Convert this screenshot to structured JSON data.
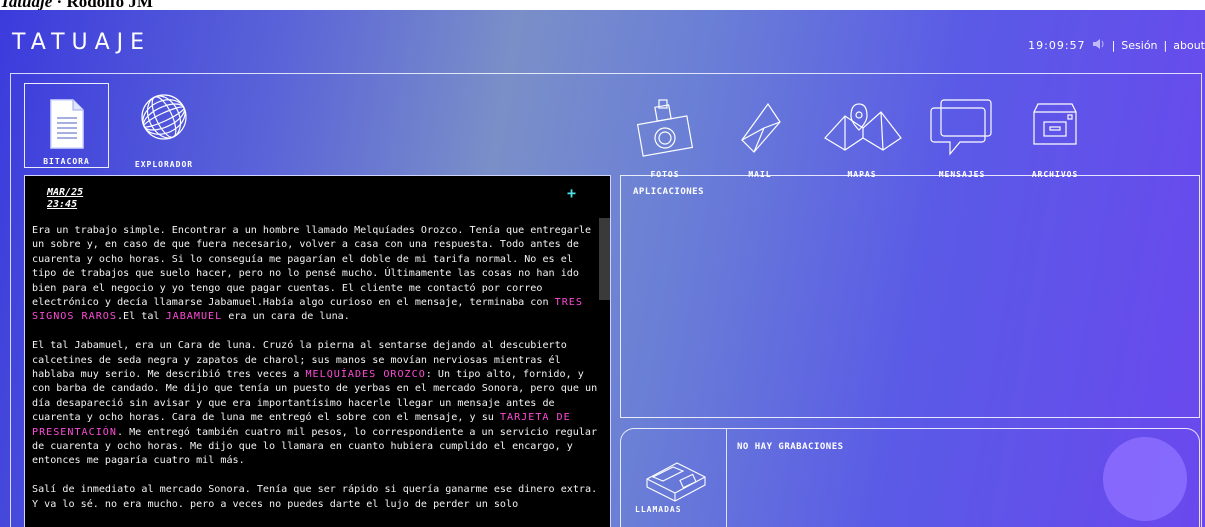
{
  "doc_title": {
    "italic": "Tatuaje",
    "rest": " · Rodolfo JM"
  },
  "app": {
    "logo": "TATUAJE",
    "clock": "19:09:57",
    "links": [
      "Sesión",
      "about"
    ],
    "separator": "|"
  },
  "left_icons": [
    {
      "label": "BITACORA",
      "icon": "document-icon",
      "selected": true
    },
    {
      "label": "EXPLORADOR",
      "icon": "globe-icon",
      "selected": false
    }
  ],
  "right_icons": [
    {
      "label": "FOTOS",
      "icon": "camera-icon"
    },
    {
      "label": "MAIL",
      "icon": "envelope-icon"
    },
    {
      "label": "MAPAS",
      "icon": "map-icon"
    },
    {
      "label": "MENSAJES",
      "icon": "chat-bubble-icon"
    },
    {
      "label": "ARCHIVOS",
      "icon": "file-cabinet-icon"
    }
  ],
  "bitacora": {
    "date": "MAR/25",
    "time": "23:45",
    "plus": "+",
    "p1a": "Era un trabajo simple. Encontrar a un hombre llamado Melquíades Orozco. Tenía que entregarle un sobre y, en caso de que fuera necesario, volver a casa con una respuesta. Todo antes de cuarenta y ocho horas. Si lo conseguía me pagarían el doble de mi tarifa normal. No es el tipo de trabajos que suelo hacer, pero no lo pensé mucho. Últimamente las cosas no han ido bien para el negocio y yo tengo que pagar cuentas. El cliente me contactó por correo electrónico y decía llamarse Jabamuel.Había algo curioso en el mensaje, terminaba con ",
    "p1_hl1": "TRES SIGNOS RAROS",
    "p1b": ".El tal ",
    "p1_hl2": "JABAMUEL",
    "p1c": " era un cara de luna.",
    "p2a": "El tal Jabamuel, era un Cara de luna. Cruzó la pierna al sentarse dejando al descubierto calcetines de seda negra y zapatos de charol; sus manos se movían nerviosas mientras él hablaba muy serio. Me describió tres veces a ",
    "p2_hl1": "MELQUÍADES OROZCO",
    "p2b": ": Un tipo alto, fornido, y con barba de candado. Me dijo que tenía un puesto de yerbas en el mercado Sonora, pero que un día desapareció sin avisar y que era importantísimo hacerle llegar un mensaje antes de cuarenta y ocho horas. Cara de luna me entregó el sobre con el mensaje, y su ",
    "p2_hl2": "TARJETA DE PRESENTACIÓN",
    "p2c": ". Me entregó también cuatro mil pesos, lo correspondiente a un servicio regular de cuarenta y ocho horas. Me dijo que lo llamara en cuanto hubiera cumplido el encargo, y entonces me pagaría cuatro mil más.",
    "p3": "Salí de inmediato al mercado Sonora. Tenía que ser rápido si quería ganarme ese dinero extra. Y va lo sé. no era mucho. pero a veces no puedes darte el lujo de perder un solo"
  },
  "aplicaciones": {
    "title": "APLICACIONES"
  },
  "llamadas": {
    "label": "LLAMADAS",
    "status": "NO HAY GRABACIONES"
  },
  "colors": {
    "highlight": "#ff4bd8",
    "plus": "#4de0e6",
    "panel_bg": "#000000"
  }
}
